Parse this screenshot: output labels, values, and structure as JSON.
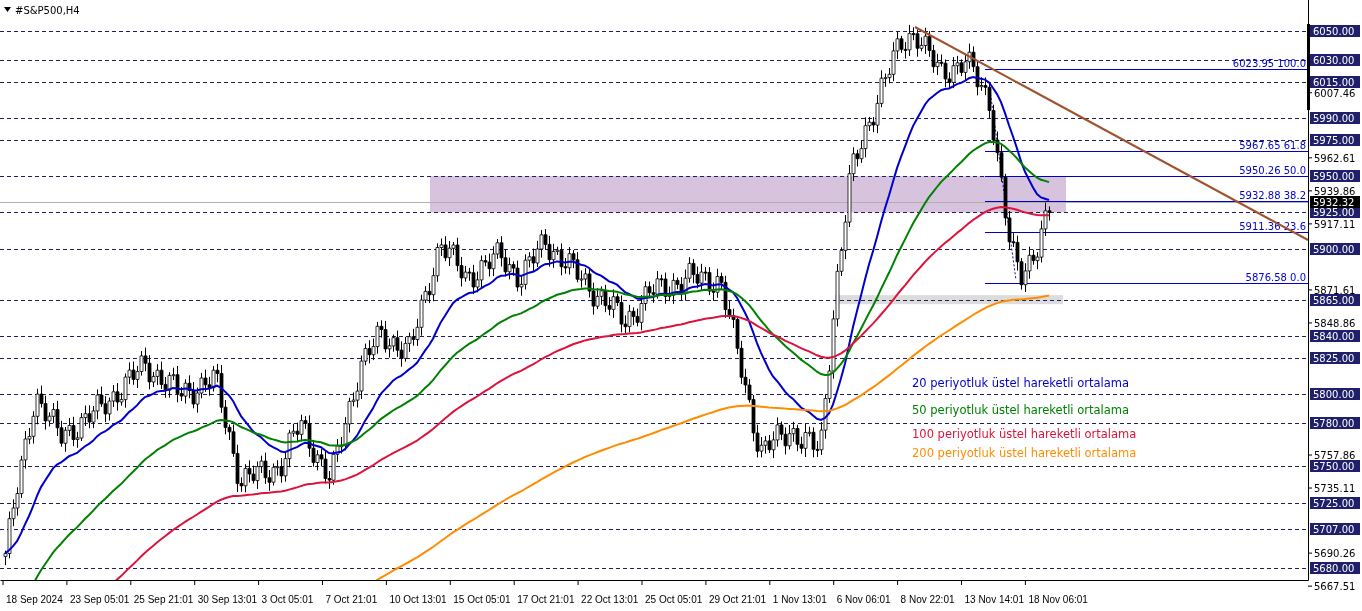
{
  "chart": {
    "title": "#S&P500,H4",
    "price_ticks": [
      "6007.46",
      "5962.61",
      "5939.86",
      "5917.11",
      "5871.61",
      "5848.86",
      "5757.86",
      "5735.11",
      "5690.26",
      "5667.51"
    ],
    "levels": [
      "6050.00",
      "6030.00",
      "6015.00",
      "5990.00",
      "5975.00",
      "5950.00",
      "5925.00",
      "5900.00",
      "5865.00",
      "5840.00",
      "5825.00",
      "5800.00",
      "5780.00",
      "5750.00",
      "5725.00",
      "5707.00",
      "5680.00"
    ],
    "current_price": "5932.32",
    "fibonacci": [
      "6023.95 100.0",
      "5967.65 61.8",
      "5950.26 50.0",
      "5932.88 38.2",
      "5911.36 23.6",
      "5876.58 0.0"
    ],
    "time_labels": [
      "18 Sep 2024",
      "23 Sep 05:01",
      "25 Sep 21:01",
      "30 Sep 13:01",
      "3 Oct 05:01",
      "7 Oct 21:01",
      "10 Oct 13:01",
      "15 Oct 05:01",
      "17 Oct 21:01",
      "22 Oct 13:01",
      "25 Oct 05:01",
      "29 Oct 21:01",
      "1 Nov 13:01",
      "6 Nov 06:01",
      "8 Nov 22:01",
      "13 Nov 14:01",
      "18 Nov 06:01"
    ],
    "legend": [
      {
        "label": "20 periyotluk üstel hareketli ortalama",
        "color": "#0000cd"
      },
      {
        "label": "50 periyotluk üstel hareketli ortalama",
        "color": "#008000"
      },
      {
        "label": "100 periyotluk üstel hareketli ortalama",
        "color": "#dc143c"
      },
      {
        "label": "200 periyotluk üstel hareketli ortalama",
        "color": "#ff8c00"
      }
    ]
  }
}
